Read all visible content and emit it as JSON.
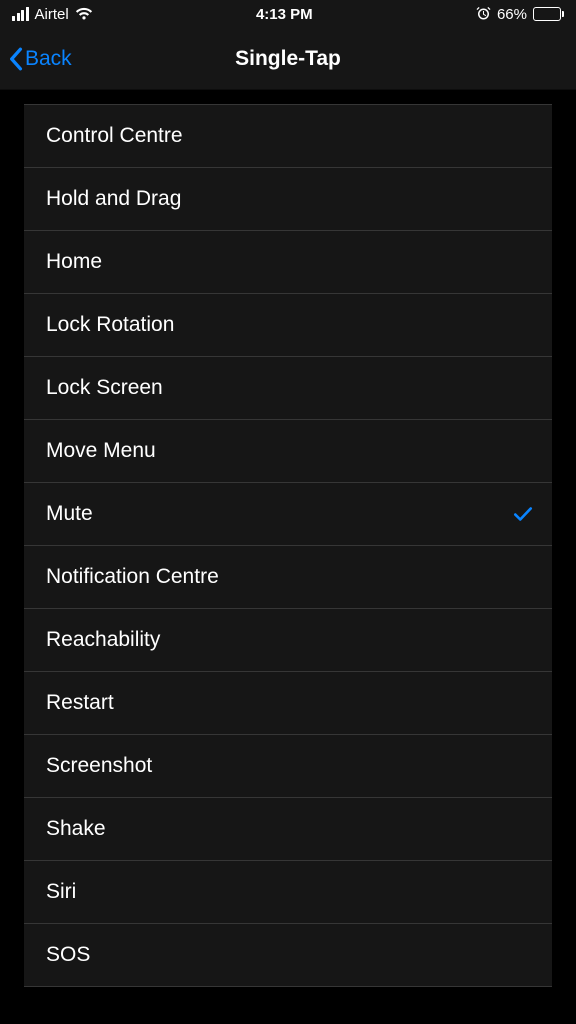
{
  "statusBar": {
    "carrier": "Airtel",
    "time": "4:13 PM",
    "batteryPercent": "66%"
  },
  "nav": {
    "back": "Back",
    "title": "Single-Tap"
  },
  "options": [
    {
      "label": "Control Centre",
      "selected": false
    },
    {
      "label": "Hold and Drag",
      "selected": false
    },
    {
      "label": "Home",
      "selected": false
    },
    {
      "label": "Lock Rotation",
      "selected": false
    },
    {
      "label": "Lock Screen",
      "selected": false
    },
    {
      "label": "Move Menu",
      "selected": false
    },
    {
      "label": "Mute",
      "selected": true
    },
    {
      "label": "Notification Centre",
      "selected": false
    },
    {
      "label": "Reachability",
      "selected": false
    },
    {
      "label": "Restart",
      "selected": false
    },
    {
      "label": "Screenshot",
      "selected": false
    },
    {
      "label": "Shake",
      "selected": false
    },
    {
      "label": "Siri",
      "selected": false
    },
    {
      "label": "SOS",
      "selected": false
    }
  ]
}
